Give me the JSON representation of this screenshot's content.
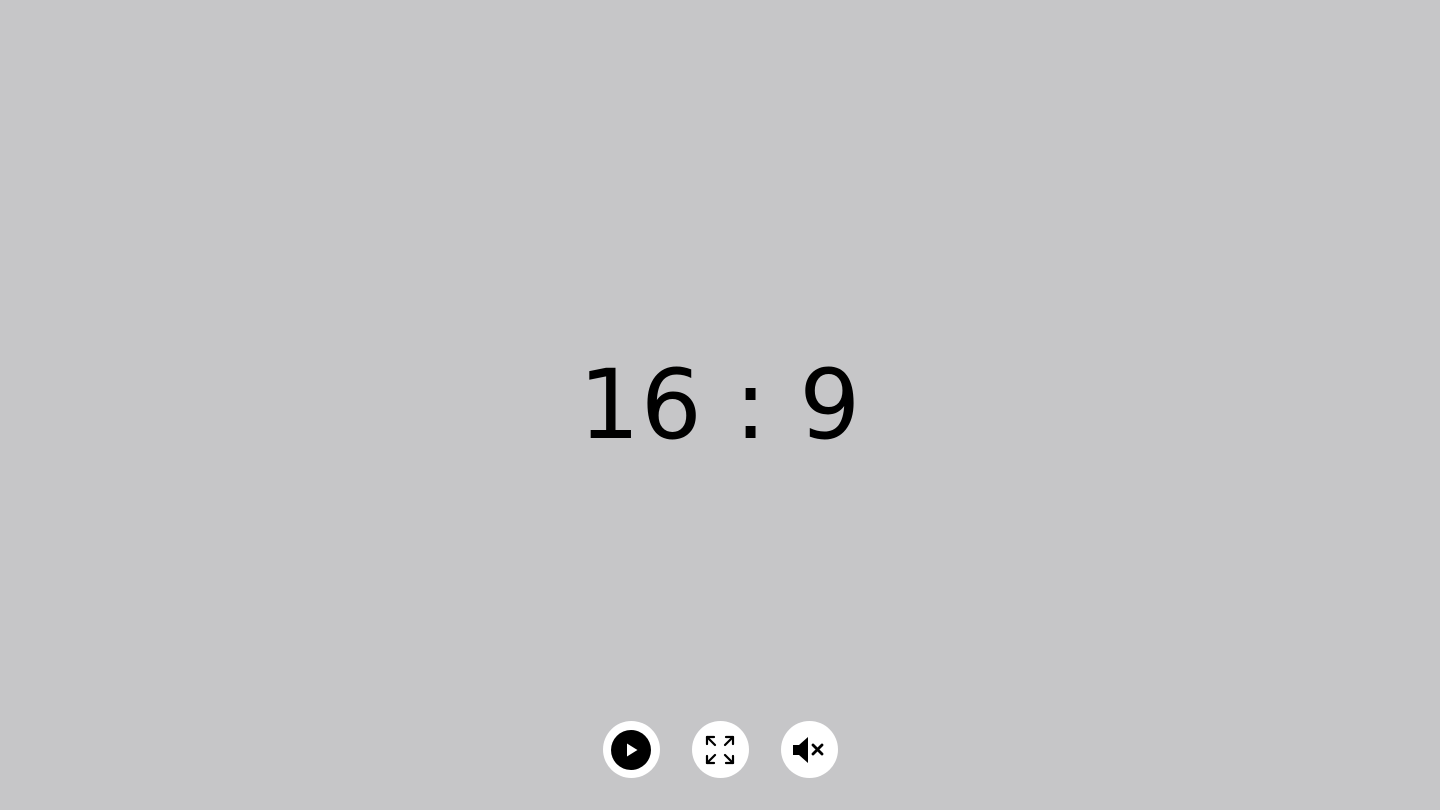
{
  "display": {
    "aspect_ratio_text": "16 : 9"
  },
  "controls": {
    "play_icon": "play-icon",
    "fullscreen_icon": "expand-icon",
    "mute_icon": "volume-muted-icon"
  },
  "colors": {
    "background": "#c6c6c8",
    "text": "#000000",
    "button_background": "#ffffff",
    "icon": "#000000"
  }
}
